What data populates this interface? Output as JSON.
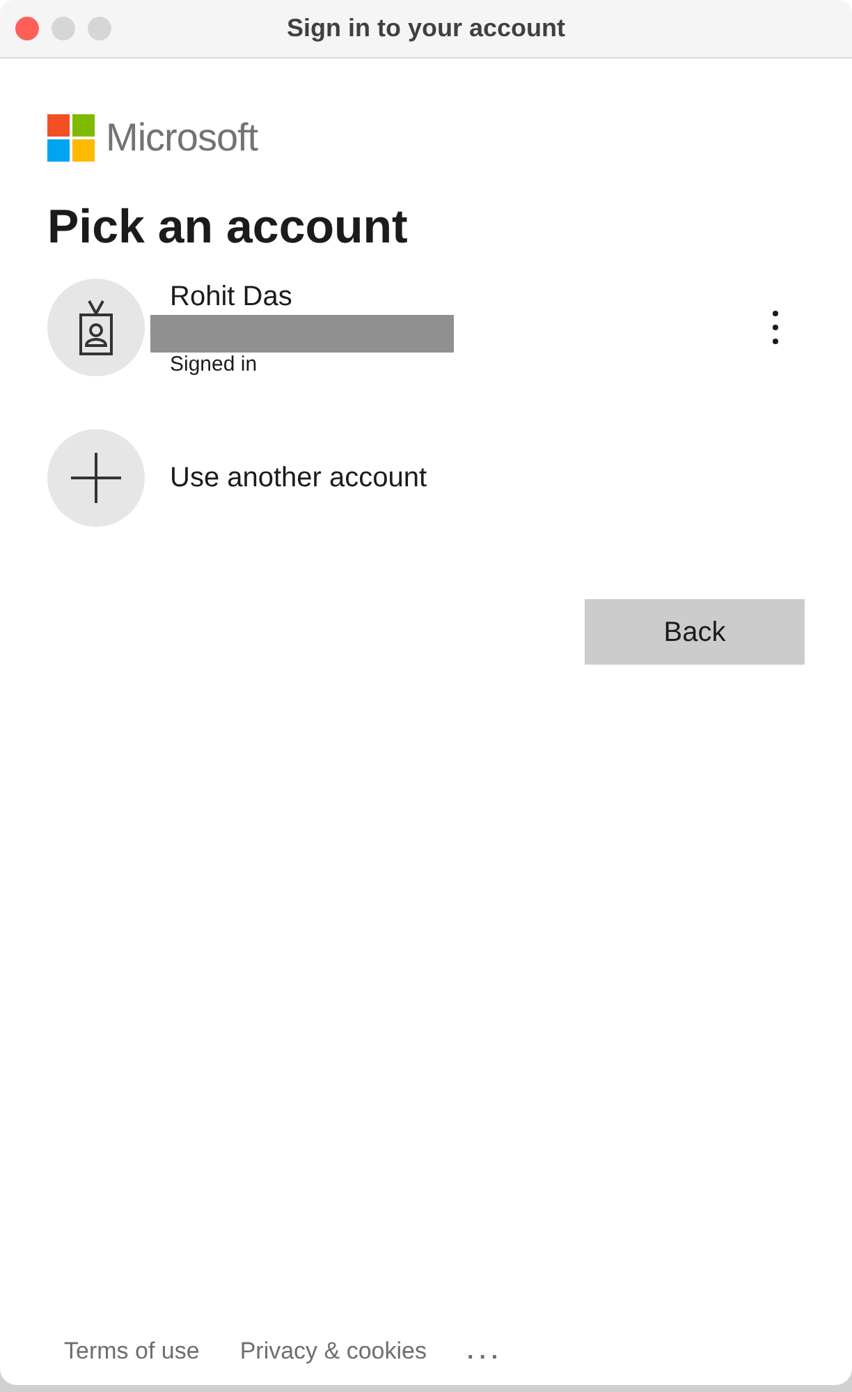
{
  "window": {
    "title": "Sign in to your account"
  },
  "brand": {
    "name": "Microsoft"
  },
  "heading": "Pick an account",
  "accounts": [
    {
      "kind": "signed_in",
      "name": "Rohit Das",
      "status": "Signed in",
      "redacted": true
    },
    {
      "kind": "add",
      "name": "Use another account"
    }
  ],
  "buttons": [
    {
      "label": "Back"
    }
  ],
  "footer": {
    "links": [
      "Terms of use",
      "Privacy & cookies"
    ],
    "more": "..."
  }
}
